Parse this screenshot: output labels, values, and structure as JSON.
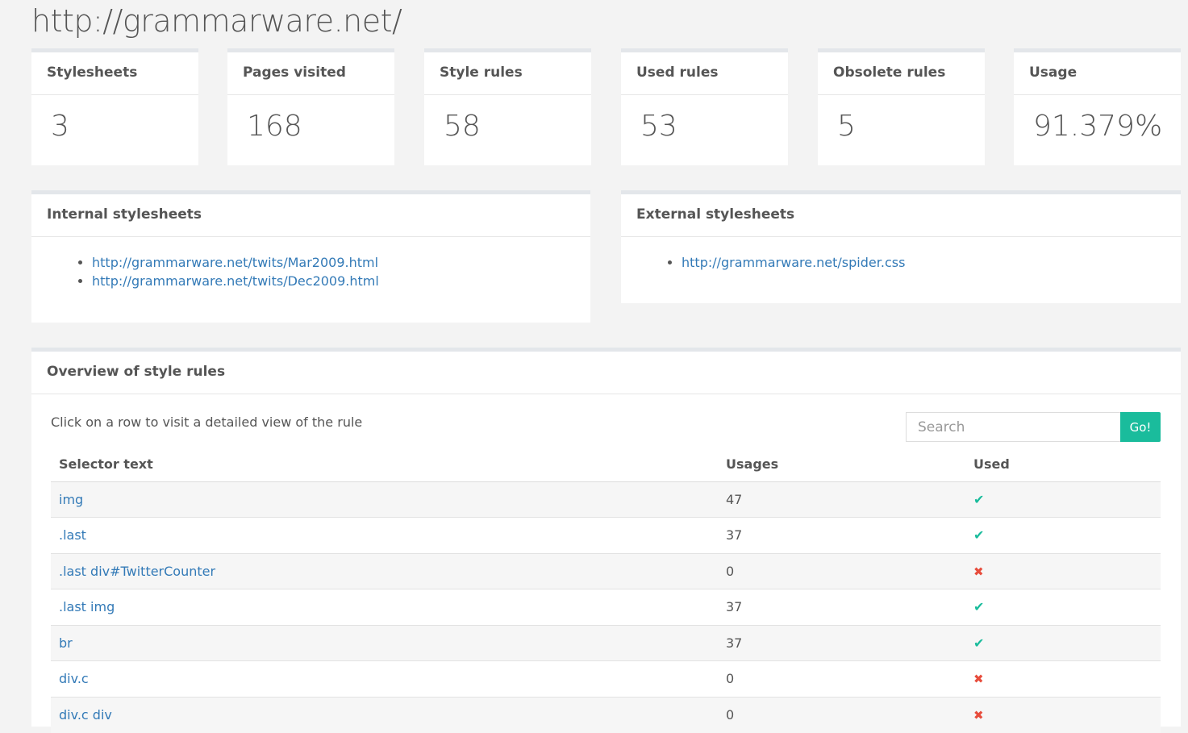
{
  "page": {
    "title": "http://grammarware.net/"
  },
  "stats": [
    {
      "label": "Stylesheets",
      "value": "3"
    },
    {
      "label": "Pages visited",
      "value": "168"
    },
    {
      "label": "Style rules",
      "value": "58"
    },
    {
      "label": "Used rules",
      "value": "53"
    },
    {
      "label": "Obsolete rules",
      "value": "5"
    },
    {
      "label": "Usage",
      "value": "91.379%"
    }
  ],
  "internal": {
    "title": "Internal stylesheets",
    "items": [
      "http://grammarware.net/twits/Mar2009.html",
      "http://grammarware.net/twits/Dec2009.html"
    ]
  },
  "external": {
    "title": "External stylesheets",
    "items": [
      "http://grammarware.net/spider.css"
    ]
  },
  "overview": {
    "title": "Overview of style rules",
    "hint": "Click on a row to visit a detailed view of the rule",
    "search_placeholder": "Search",
    "go_label": "Go!",
    "columns": [
      "Selector text",
      "Usages",
      "Used"
    ],
    "rows": [
      {
        "selector": "img",
        "usages": "47",
        "used": true
      },
      {
        "selector": ".last",
        "usages": "37",
        "used": true
      },
      {
        "selector": ".last div#TwitterCounter",
        "usages": "0",
        "used": false
      },
      {
        "selector": ".last img",
        "usages": "37",
        "used": true
      },
      {
        "selector": "br",
        "usages": "37",
        "used": true
      },
      {
        "selector": "div.c",
        "usages": "0",
        "used": false
      },
      {
        "selector": "div.c div",
        "usages": "0",
        "used": false
      }
    ]
  },
  "icons": {
    "used": "check-icon",
    "unused": "cross-icon"
  },
  "colors": {
    "accent": "#1abc9c",
    "link": "#337ab7",
    "danger": "#e74c3c",
    "background": "#f3f3f3"
  }
}
